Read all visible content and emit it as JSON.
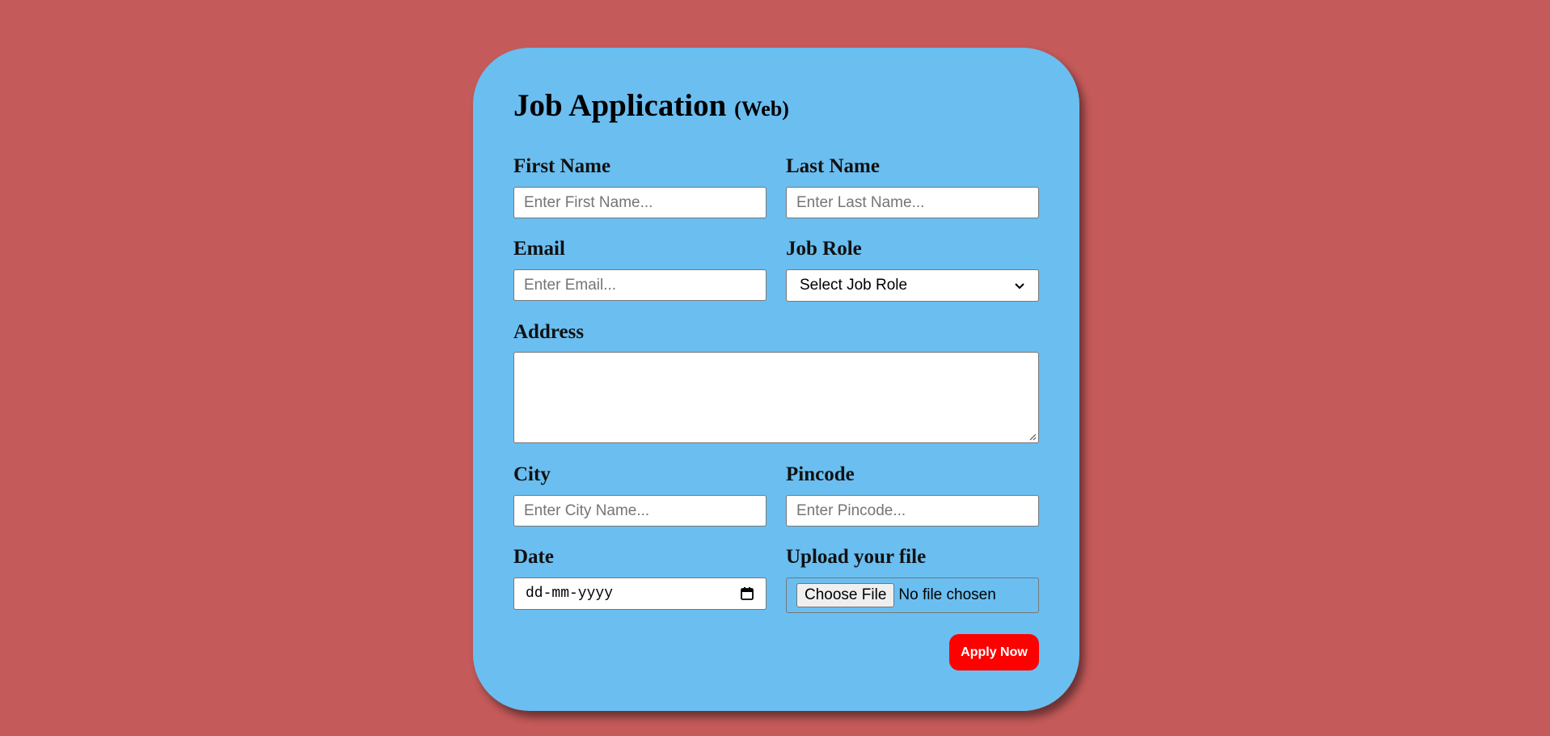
{
  "form": {
    "title": "Job Application",
    "subtitle": "(Web)",
    "first_name": {
      "label": "First Name",
      "placeholder": "Enter First Name..."
    },
    "last_name": {
      "label": "Last Name",
      "placeholder": "Enter Last Name..."
    },
    "email": {
      "label": "Email",
      "placeholder": "Enter Email..."
    },
    "job_role": {
      "label": "Job Role",
      "selected": "Select Job Role"
    },
    "address": {
      "label": "Address"
    },
    "city": {
      "label": "City",
      "placeholder": "Enter City Name..."
    },
    "pincode": {
      "label": "Pincode",
      "placeholder": "Enter Pincode..."
    },
    "date": {
      "label": "Date",
      "value": "dd-mm-yyyy"
    },
    "upload": {
      "label": "Upload your file",
      "button": "Choose File",
      "status": "No file chosen"
    },
    "submit_label": "Apply Now"
  },
  "colors": {
    "page_background": "#c55a5a",
    "card_background": "#6bbef0",
    "submit_button": "#ff0000"
  },
  "icons": {
    "job_role_dropdown": "chevron-down-icon",
    "date_picker": "calendar-icon",
    "address_resize": "resize-grip-icon"
  }
}
